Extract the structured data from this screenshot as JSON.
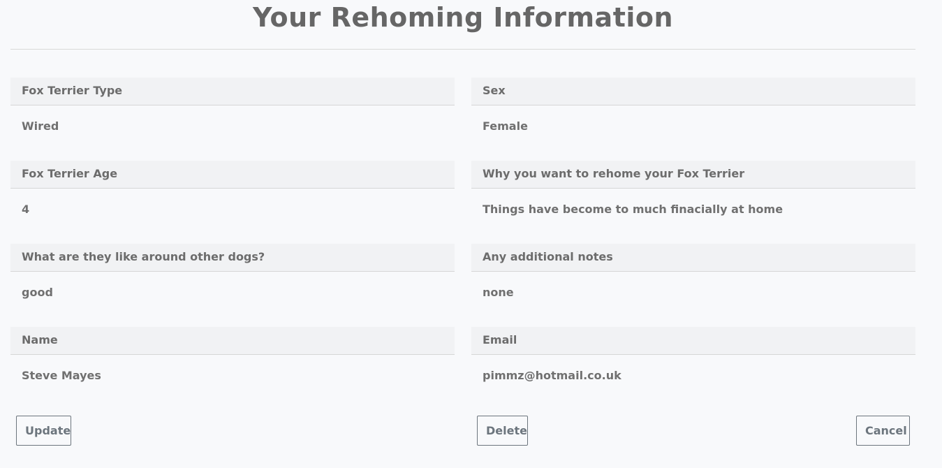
{
  "page": {
    "title": "Your Rehoming Information"
  },
  "fields": [
    {
      "label": "Fox Terrier Type",
      "value": "Wired"
    },
    {
      "label": "Sex",
      "value": "Female"
    },
    {
      "label": "Fox Terrier Age",
      "value": "4"
    },
    {
      "label": "Why you want to rehome your Fox Terrier",
      "value": "Things have become to much finacially at home"
    },
    {
      "label": "What are they like around other dogs?",
      "value": "good"
    },
    {
      "label": "Any additional notes",
      "value": "none"
    },
    {
      "label": "Name",
      "value": "Steve Mayes"
    },
    {
      "label": "Email",
      "value": "pimmz@hotmail.co.uk"
    }
  ],
  "actions": {
    "update_label": "Update",
    "delete_label": "Delete",
    "cancel_label": "Cancel"
  },
  "colors": {
    "background": "#f8f9fb",
    "header_background": "#f1f2f4",
    "text": "#6b6b6b",
    "button_border": "#6c757d"
  }
}
